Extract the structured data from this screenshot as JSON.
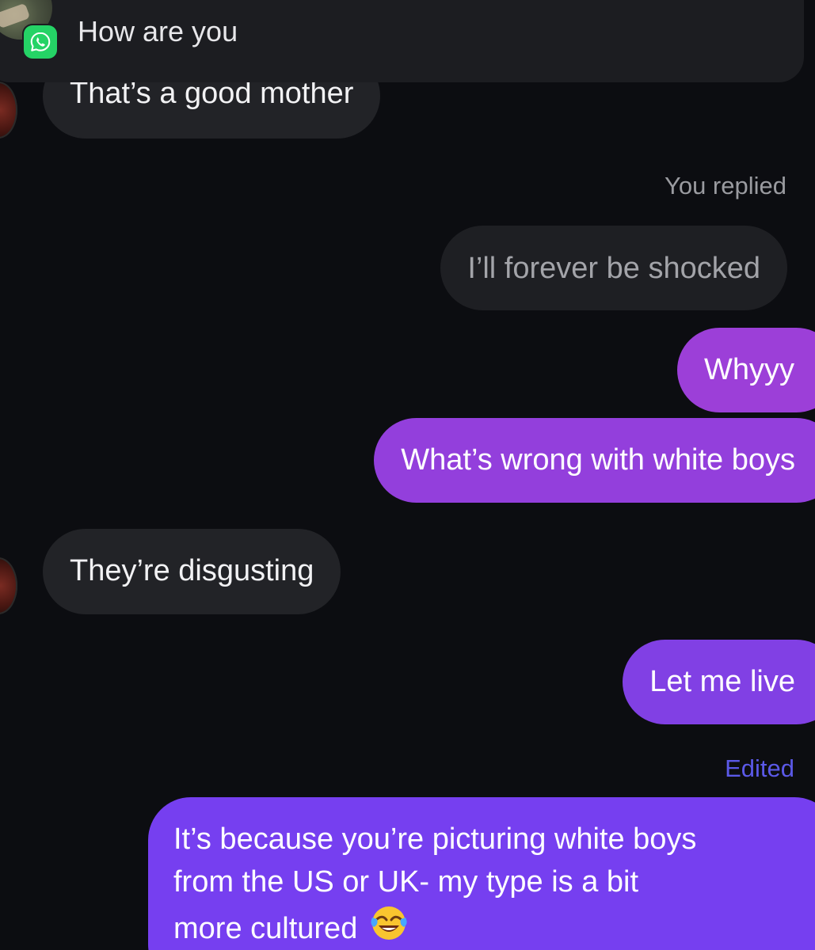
{
  "notification": {
    "app_icon": "whatsapp-icon",
    "text": "How are you"
  },
  "messages": {
    "received_1": "That’s a good mother",
    "you_replied_label": "You replied",
    "quoted_reply": "I’ll forever be shocked",
    "sent_1": "Whyyy",
    "sent_2": "What’s wrong with white boys",
    "received_2": "They’re disgusting",
    "sent_3": "Let me live",
    "edited_label": "Edited",
    "sent_4_line_1": "It’s because you’re picturing white boys",
    "sent_4_line_2": "from the US or UK- my type is a bit",
    "sent_4_line_3": "more cultured",
    "sent_4_emoji": "face-with-tears-of-joy-icon"
  },
  "colors": {
    "background": "#0c0d11",
    "received_bubble": "#222327",
    "sent_gradient_top": "#9a3fd6",
    "sent_gradient_bottom": "#6a3cf0",
    "edited_label": "#5b59e8",
    "whatsapp_green": "#25d366"
  }
}
